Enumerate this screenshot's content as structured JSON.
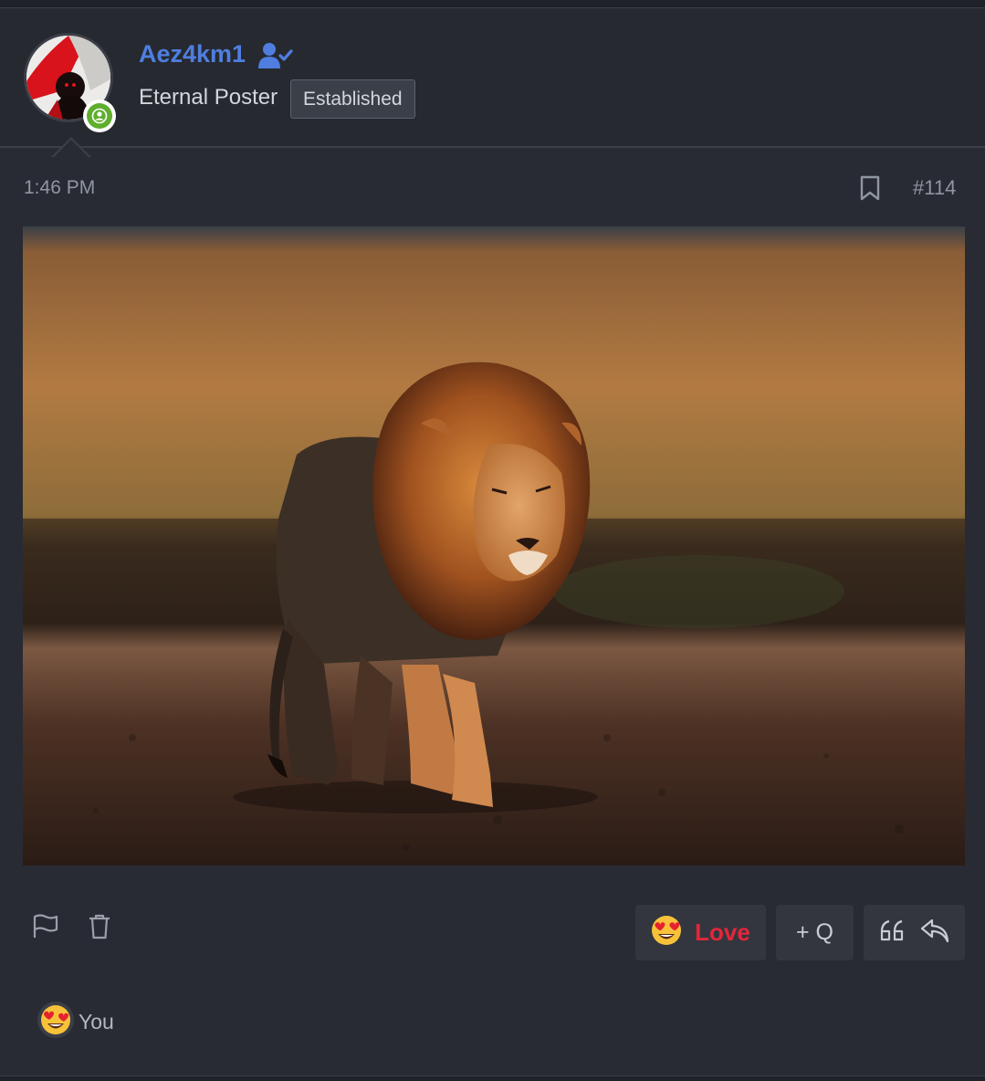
{
  "user": {
    "name": "Aez4km1",
    "title": "Eternal Poster",
    "badge": "Established",
    "status": "online"
  },
  "post": {
    "time": "1:46 PM",
    "number": "#114",
    "image_subject": "lion walking"
  },
  "actions": {
    "love_label": "Love",
    "multiquote_label": "+ Q"
  },
  "reactions": {
    "summary": "You"
  },
  "icons": {
    "verified": "user-check-icon",
    "online": "online-user-icon",
    "bookmark": "bookmark-icon",
    "report": "flag-icon",
    "delete": "trash-icon",
    "love": "heart-eyes-emoji-icon",
    "quote": "quote-icon",
    "reply": "reply-icon"
  },
  "colors": {
    "username": "#4f7ee0",
    "love": "#e3263b",
    "online": "#5fae2e",
    "background": "#282b33"
  }
}
